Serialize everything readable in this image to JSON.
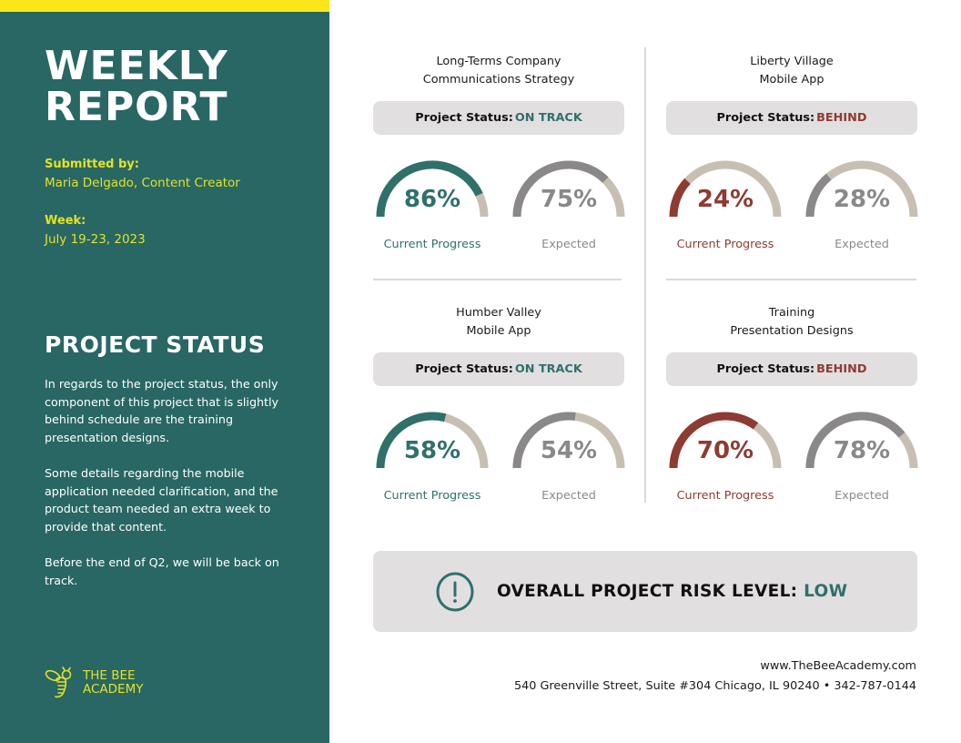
{
  "sidebar": {
    "title_line1": "WEEKLY",
    "title_line2": "REPORT",
    "submitted_label": "Submitted by:",
    "submitted_value": "Maria Delgado, Content Creator",
    "week_label": "Week:",
    "week_value": "July 19-23, 2023",
    "status_heading": "PROJECT STATUS",
    "paragraphs": [
      "In regards to the project status, the only component of this project that is slightly behind schedule are the training presentation designs.",
      "Some details regarding the mobile application needed clarification, and the product team needed an extra week to provide that content.",
      "Before the end of Q2, we will be back on track."
    ],
    "logo_line1": "THE BEE",
    "logo_line2": "ACADEMY",
    "logo_icon": "bee-icon"
  },
  "colors": {
    "sidebar_bg": "#286763",
    "accent_yellow": "#fbe51b",
    "on_track": "#2f706b",
    "behind": "#8e3b32",
    "expected": "#8a8888",
    "track": "#c8bfb3",
    "pill_bg": "#e2dfe0"
  },
  "projects": [
    {
      "title_line1": "Long-Terms Company",
      "title_line2": "Communications Strategy",
      "status_label": "Project Status:",
      "status_value": "ON TRACK",
      "status_kind": "on_track",
      "current": {
        "value": 86,
        "text": "86%",
        "label": "Current Progress"
      },
      "expected": {
        "value": 75,
        "text": "75%",
        "label": "Expected"
      }
    },
    {
      "title_line1": "Liberty Village",
      "title_line2": "Mobile App",
      "status_label": "Project Status:",
      "status_value": "BEHIND",
      "status_kind": "behind",
      "current": {
        "value": 24,
        "text": "24%",
        "label": "Current Progress"
      },
      "expected": {
        "value": 28,
        "text": "28%",
        "label": "Expected"
      }
    },
    {
      "title_line1": "Humber Valley",
      "title_line2": "Mobile App",
      "status_label": "Project Status:",
      "status_value": "ON TRACK",
      "status_kind": "on_track",
      "current": {
        "value": 58,
        "text": "58%",
        "label": "Current Progress"
      },
      "expected": {
        "value": 54,
        "text": "54%",
        "label": "Expected"
      }
    },
    {
      "title_line1": "Training",
      "title_line2": "Presentation Designs",
      "status_label": "Project Status:",
      "status_value": "BEHIND",
      "status_kind": "behind",
      "current": {
        "value": 70,
        "text": "70%",
        "label": "Current Progress"
      },
      "expected": {
        "value": 78,
        "text": "78%",
        "label": "Expected"
      }
    }
  ],
  "risk": {
    "icon": "exclamation-circle-icon",
    "label": "OVERALL PROJECT RISK LEVEL:",
    "value": "LOW"
  },
  "footer": {
    "website": "www.TheBeeAcademy.com",
    "address": "540 Greenville Street, Suite #304 Chicago, IL 90240 • 342-787-0144"
  }
}
